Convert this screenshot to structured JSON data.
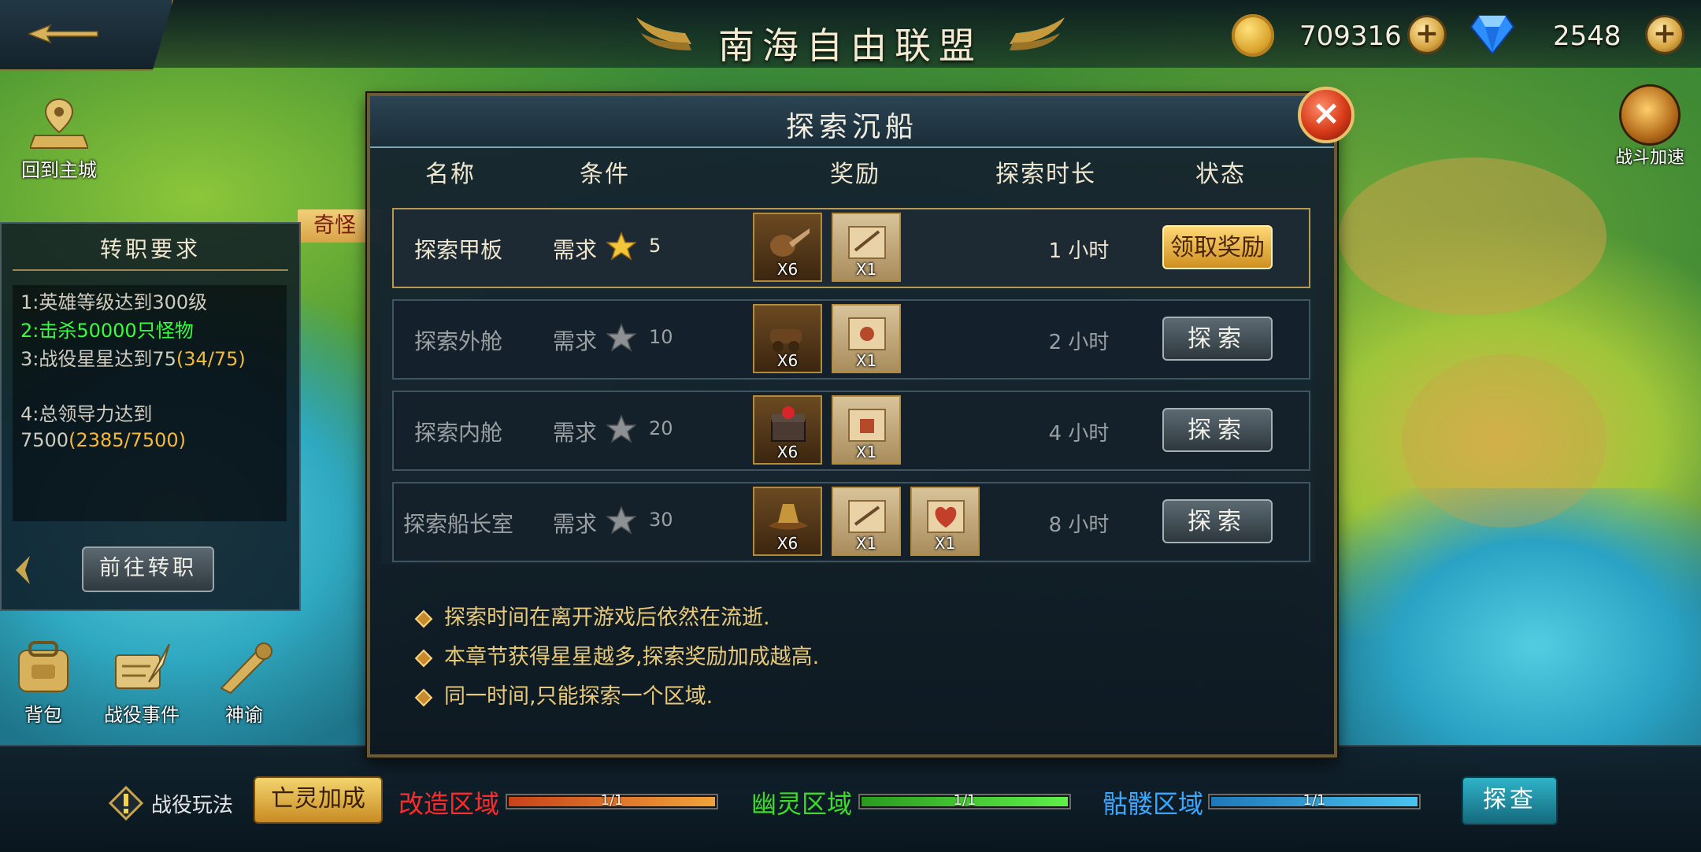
{
  "header": {
    "title": "南海自由联盟"
  },
  "resources": {
    "gold": "709316",
    "diamonds": "2548",
    "plus": "+"
  },
  "left": {
    "home_label": "回到主城",
    "strange_tag": "奇怪",
    "requirements": {
      "title": "转职要求",
      "items": [
        {
          "prefix": "1:英雄等级达到300级",
          "progress": "",
          "done": false
        },
        {
          "prefix": "2:击杀50000只怪物",
          "progress": "",
          "done": true
        },
        {
          "prefix": "3:战役星星达到75",
          "progress": "(34/75)",
          "done": false
        },
        {
          "prefix": "4:总领导力达到7500",
          "progress": "(2385/7500)",
          "done": false
        }
      ],
      "goto_label": "前往转职"
    },
    "bottom_icons": [
      "背包",
      "战役事件",
      "神谕"
    ]
  },
  "right": {
    "speed_label": "战斗加速"
  },
  "dialog": {
    "title": "探索沉船",
    "close": "×",
    "columns": [
      "名称",
      "条件",
      "奖励",
      "探索时长",
      "状态"
    ],
    "rows": [
      {
        "name": "探索甲板",
        "cond": "需求",
        "stars": "5",
        "rewards": [
          "X6",
          "X1"
        ],
        "time": "1 小时",
        "status": "领取奖励",
        "active": true
      },
      {
        "name": "探索外舱",
        "cond": "需求",
        "stars": "10",
        "rewards": [
          "X6",
          "X1"
        ],
        "time": "2 小时",
        "status": "探索",
        "active": false
      },
      {
        "name": "探索内舱",
        "cond": "需求",
        "stars": "20",
        "rewards": [
          "X6",
          "X1"
        ],
        "time": "4 小时",
        "status": "探索",
        "active": false
      },
      {
        "name": "探索船长室",
        "cond": "需求",
        "stars": "30",
        "rewards": [
          "X6",
          "X1",
          "X1"
        ],
        "time": "8 小时",
        "status": "探索",
        "active": false
      }
    ],
    "notes": [
      "探索时间在离开游戏后依然在流逝.",
      "本章节获得星星越多,探索奖励加成越高.",
      "同一时间,只能探索一个区域."
    ]
  },
  "bottom": {
    "campaign_label": "战役玩法",
    "undead_btn": "亡灵加成",
    "zones": [
      {
        "name": "改造区域",
        "progress": "1/1",
        "color": "#ff2b2b",
        "fill": "#e07a2a",
        "fraction": 1.0
      },
      {
        "name": "幽灵区域",
        "progress": "1/1",
        "color": "#3ddc2a",
        "fill": "#3ccf2e",
        "fraction": 1.0
      },
      {
        "name": "骷髅区域",
        "progress": "1/1",
        "color": "#3aa8ff",
        "fill": "#2e9ed8",
        "fraction": 1.0
      }
    ],
    "inspect_btn": "探查"
  }
}
